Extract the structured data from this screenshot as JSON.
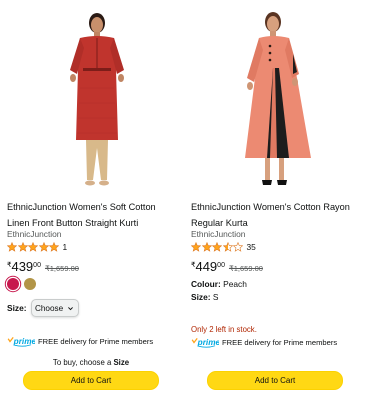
{
  "products": [
    {
      "title": "EthnicJunction Women's Soft Cotton Linen Front Button Straight Kurti",
      "brand": "EthnicJunction",
      "rating_value": 5,
      "rating_count": "1",
      "currency": "₹",
      "price_whole": "439",
      "price_fraction": "00",
      "mrp": "₹1,659.00",
      "swatch_colors": [
        "#c7184d",
        "#b29547"
      ],
      "size_label": "Size:",
      "size_select_value": "Choose",
      "prime_text": "FREE delivery for Prime members",
      "note_prefix": "To buy, choose a",
      "note_bold": "Size",
      "cart_label": "Add to Cart"
    },
    {
      "title": "EthnicJunction Women's Cotton Rayon Regular Kurta",
      "brand": "EthnicJunction",
      "rating_value": 3.5,
      "rating_count": "35",
      "currency": "₹",
      "price_whole": "449",
      "price_fraction": "00",
      "mrp": "₹1,659.00",
      "colour_label": "Colour:",
      "colour_value": "Peach",
      "size_label": "Size:",
      "size_value": "S",
      "stock_text": "Only 2 left in stock.",
      "prime_text": "FREE delivery for Prime members",
      "cart_label": "Add to Cart"
    }
  ],
  "prime_logo_text": "prime",
  "colors": {
    "star": "#ffa41c",
    "button": "#ffd814",
    "prime_blue": "#00a8e1",
    "stock_red": "#b12704",
    "muted": "#565959"
  }
}
